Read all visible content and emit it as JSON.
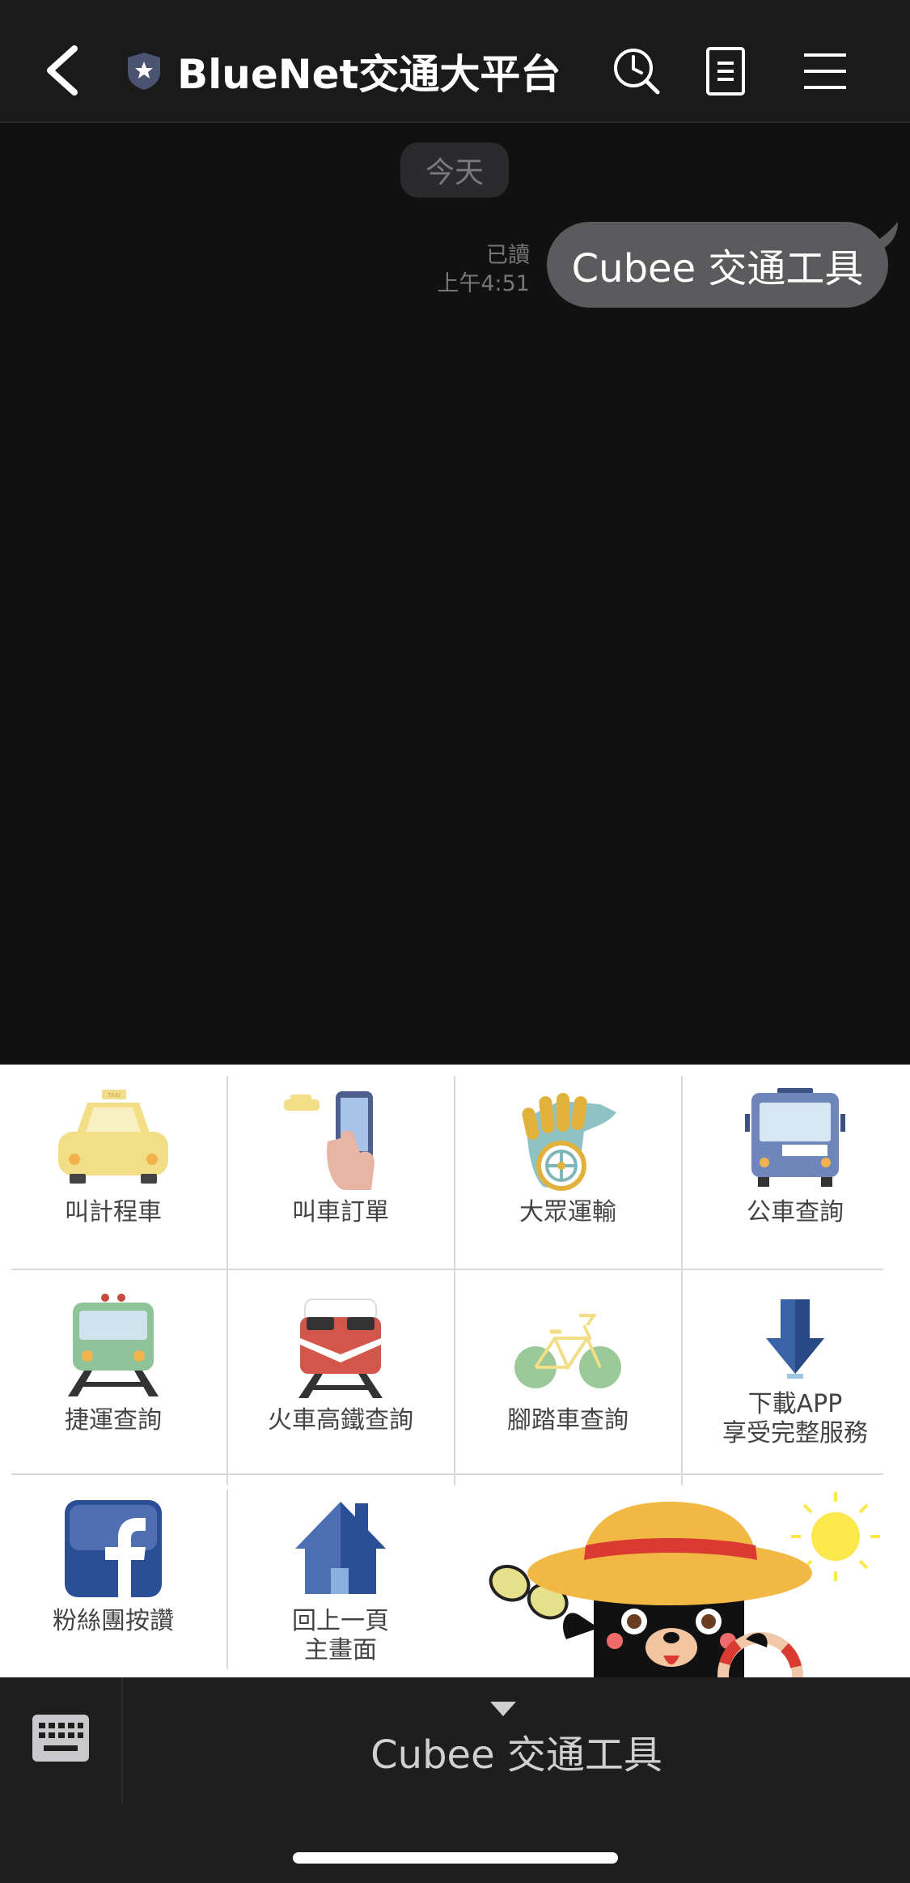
{
  "header": {
    "back_icon": "back-chevron-icon",
    "verified_icon": "shield-star-icon",
    "title": "BlueNet交通大平台",
    "search_icon": "search-clock-icon",
    "notes_icon": "notes-icon",
    "menu_icon": "hamburger-menu-icon"
  },
  "chat": {
    "date_divider": "今天",
    "message": {
      "read_status": "已讀",
      "time": "上午4:51",
      "text": "Cubee 交通工具"
    }
  },
  "rich_menu": {
    "items": [
      {
        "label": "叫計程車",
        "icon": "taxi-icon"
      },
      {
        "label": "叫車訂單",
        "icon": "phone-taxi-order-icon"
      },
      {
        "label": "大眾運輸",
        "icon": "public-transport-hand-icon"
      },
      {
        "label": "公車查詢",
        "icon": "bus-icon"
      },
      {
        "label": "捷運查詢",
        "icon": "metro-train-icon"
      },
      {
        "label": "火車高鐵查詢",
        "icon": "railway-train-icon"
      },
      {
        "label": "腳踏車查詢",
        "icon": "bicycle-icon"
      },
      {
        "label_line1": "下載APP",
        "label_line2": "享受完整服務",
        "icon": "download-arrow-icon"
      },
      {
        "label": "粉絲團按讚",
        "icon": "facebook-icon"
      },
      {
        "label_line1": "回上一頁",
        "label_line2": "主畫面",
        "icon": "home-icon"
      }
    ],
    "mascot": "cubee-bear-mascot-illustration"
  },
  "bottom_bar": {
    "keyboard_icon": "keyboard-icon",
    "menu_title": "Cubee 交通工具",
    "caret_icon": "caret-down-icon"
  },
  "colors": {
    "background": "#111112",
    "header": "#1a1a1b",
    "bubble": "#5b5b5e",
    "menu_bg": "#ffffff",
    "bottom_bar": "#1e1e1f"
  }
}
